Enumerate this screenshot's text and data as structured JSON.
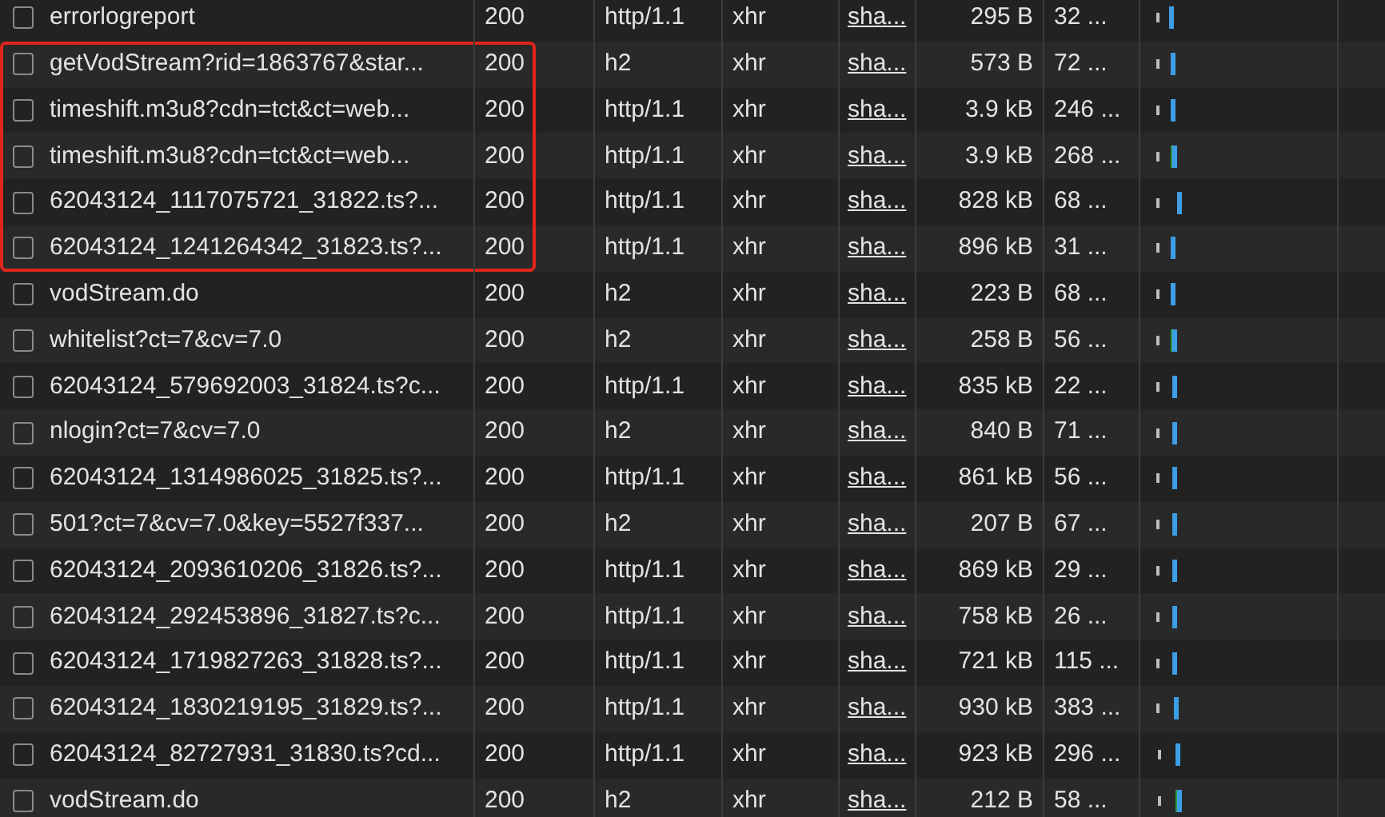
{
  "rows": [
    {
      "name": "errorlogreport",
      "status": "200",
      "protocol": "http/1.1",
      "type": "xhr",
      "initiator": "sha...",
      "size": "295 B",
      "time": "32 ...",
      "highlighted": false
    },
    {
      "name": "getVodStream?rid=1863767&star...",
      "status": "200",
      "protocol": "h2",
      "type": "xhr",
      "initiator": "sha...",
      "size": "573 B",
      "time": "72 ...",
      "highlighted": true
    },
    {
      "name": "timeshift.m3u8?cdn=tct&ct=web...",
      "status": "200",
      "protocol": "http/1.1",
      "type": "xhr",
      "initiator": "sha...",
      "size": "3.9 kB",
      "time": "246 ...",
      "highlighted": true
    },
    {
      "name": "timeshift.m3u8?cdn=tct&ct=web...",
      "status": "200",
      "protocol": "http/1.1",
      "type": "xhr",
      "initiator": "sha...",
      "size": "3.9 kB",
      "time": "268 ...",
      "highlighted": true
    },
    {
      "name": "62043124_1117075721_31822.ts?...",
      "status": "200",
      "protocol": "http/1.1",
      "type": "xhr",
      "initiator": "sha...",
      "size": "828 kB",
      "time": "68 ...",
      "highlighted": true
    },
    {
      "name": "62043124_1241264342_31823.ts?...",
      "status": "200",
      "protocol": "http/1.1",
      "type": "xhr",
      "initiator": "sha...",
      "size": "896 kB",
      "time": "31 ...",
      "highlighted": true
    },
    {
      "name": "vodStream.do",
      "status": "200",
      "protocol": "h2",
      "type": "xhr",
      "initiator": "sha...",
      "size": "223 B",
      "time": "68 ...",
      "highlighted": false
    },
    {
      "name": "whitelist?ct=7&cv=7.0",
      "status": "200",
      "protocol": "h2",
      "type": "xhr",
      "initiator": "sha...",
      "size": "258 B",
      "time": "56 ...",
      "highlighted": false
    },
    {
      "name": "62043124_579692003_31824.ts?c...",
      "status": "200",
      "protocol": "http/1.1",
      "type": "xhr",
      "initiator": "sha...",
      "size": "835 kB",
      "time": "22 ...",
      "highlighted": false
    },
    {
      "name": "nlogin?ct=7&cv=7.0",
      "status": "200",
      "protocol": "h2",
      "type": "xhr",
      "initiator": "sha...",
      "size": "840 B",
      "time": "71 ...",
      "highlighted": false
    },
    {
      "name": "62043124_1314986025_31825.ts?...",
      "status": "200",
      "protocol": "http/1.1",
      "type": "xhr",
      "initiator": "sha...",
      "size": "861 kB",
      "time": "56 ...",
      "highlighted": false
    },
    {
      "name": "501?ct=7&cv=7.0&key=5527f337...",
      "status": "200",
      "protocol": "h2",
      "type": "xhr",
      "initiator": "sha...",
      "size": "207 B",
      "time": "67 ...",
      "highlighted": false
    },
    {
      "name": "62043124_2093610206_31826.ts?...",
      "status": "200",
      "protocol": "http/1.1",
      "type": "xhr",
      "initiator": "sha...",
      "size": "869 kB",
      "time": "29 ...",
      "highlighted": false
    },
    {
      "name": "62043124_292453896_31827.ts?c...",
      "status": "200",
      "protocol": "http/1.1",
      "type": "xhr",
      "initiator": "sha...",
      "size": "758 kB",
      "time": "26 ...",
      "highlighted": false
    },
    {
      "name": "62043124_1719827263_31828.ts?...",
      "status": "200",
      "protocol": "http/1.1",
      "type": "xhr",
      "initiator": "sha...",
      "size": "721 kB",
      "time": "115 ...",
      "highlighted": false
    },
    {
      "name": "62043124_1830219195_31829.ts?...",
      "status": "200",
      "protocol": "http/1.1",
      "type": "xhr",
      "initiator": "sha...",
      "size": "930 kB",
      "time": "383 ...",
      "highlighted": false
    },
    {
      "name": "62043124_82727931_31830.ts?cd...",
      "status": "200",
      "protocol": "http/1.1",
      "type": "xhr",
      "initiator": "sha...",
      "size": "923 kB",
      "time": "296 ...",
      "highlighted": false
    },
    {
      "name": "vodStream.do",
      "status": "200",
      "protocol": "h2",
      "type": "xhr",
      "initiator": "sha...",
      "size": "212 B",
      "time": "58 ...",
      "highlighted": false
    }
  ]
}
